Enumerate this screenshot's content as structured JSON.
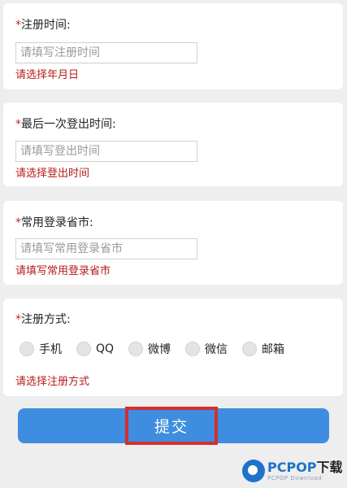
{
  "form": {
    "register_time": {
      "required_mark": "*",
      "label": "注册时间:",
      "placeholder": "请填写注册时间",
      "error": "请选择年月日"
    },
    "last_logout_time": {
      "required_mark": "*",
      "label": "最后一次登出时间:",
      "placeholder": "请填写登出时间",
      "error": "请选择登出时间"
    },
    "login_location": {
      "required_mark": "*",
      "label": "常用登录省市:",
      "placeholder": "请填写常用登录省市",
      "error": "请填写常用登录省市"
    },
    "register_method": {
      "required_mark": "*",
      "label": "注册方式:",
      "options": [
        "手机",
        "QQ",
        "微博",
        "微信",
        "邮箱"
      ],
      "error": "请选择注册方式"
    },
    "submit_label": "提交"
  },
  "watermark": {
    "brand": "PCPOP",
    "brand_cn": "下载",
    "sub": "PCPOP Download"
  },
  "colors": {
    "error": "#b71c1c",
    "submit_bg": "#3e8de0",
    "highlight_border": "#d32f2f"
  }
}
